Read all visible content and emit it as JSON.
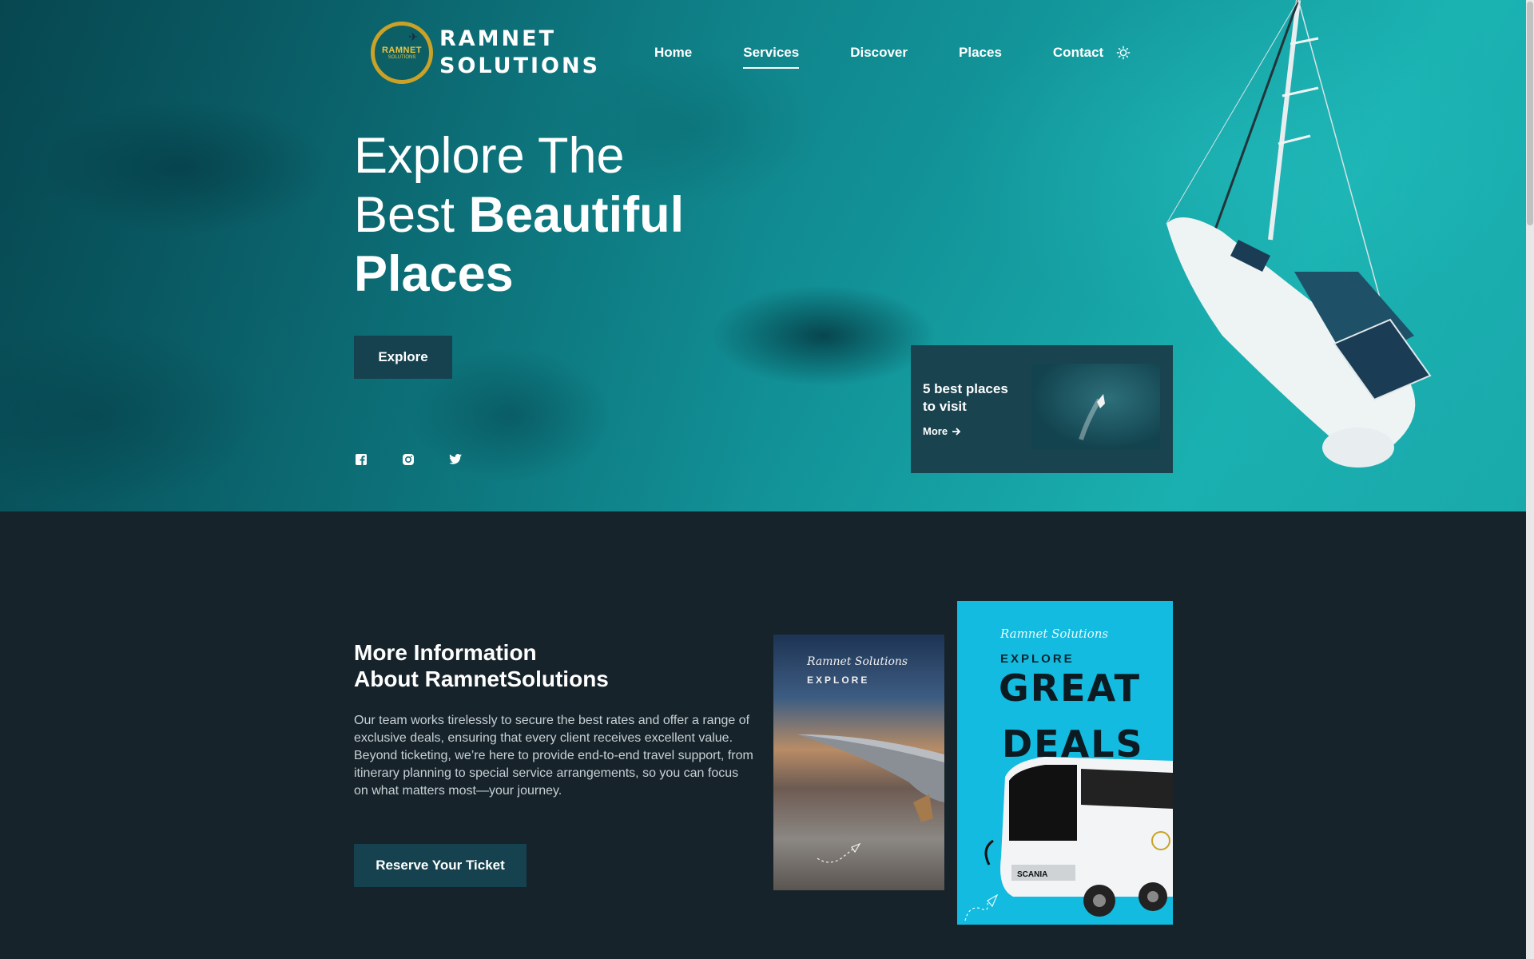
{
  "brand": {
    "line1": "RAMNET",
    "line2": "SOLUTIONS",
    "badge_text": "RAMNET",
    "badge_sub": "SOLUTIONS",
    "gold": "#c9a227"
  },
  "nav": {
    "items": [
      {
        "label": "Home",
        "active": false
      },
      {
        "label": "Services",
        "active": true
      },
      {
        "label": "Discover",
        "active": false
      },
      {
        "label": "Places",
        "active": false
      },
      {
        "label": "Contact",
        "active": false
      }
    ],
    "theme_icon": "sun-icon"
  },
  "hero": {
    "title_line1": "Explore The",
    "title_line2_light": "Best ",
    "title_line2_bold": "Beautiful",
    "title_line3": "Places",
    "cta_label": "Explore",
    "socials": [
      "facebook-icon",
      "instagram-icon",
      "twitter-icon"
    ],
    "card": {
      "title": "5 best places to visit",
      "more_label": "More",
      "more_icon": "arrow-right-icon"
    }
  },
  "about": {
    "title_line1": "More Information",
    "title_line2": "About RamnetSolutions",
    "body": "Our team works tirelessly to secure the best rates and offer a range of exclusive deals, ensuring that every client receives excellent value. Beyond ticketing, we’re here to provide end-to-end travel support, from itinerary planning to special service arrangements, so you can focus on what matters most—your journey.",
    "cta_label": "Reserve Your Ticket",
    "promo1": {
      "brand": "Ramnet Solutions",
      "label": "EXPLORE"
    },
    "promo2": {
      "brand": "Ramnet Solutions",
      "label": "EXPLORE",
      "headline1": "GREAT",
      "headline2": "DEALS",
      "bus_label": "SCANIA"
    }
  },
  "colors": {
    "page_bg": "#16232a",
    "button_bg": "#16424f",
    "card_bg": "#19434f",
    "promo_cyan": "#12bbdf"
  }
}
